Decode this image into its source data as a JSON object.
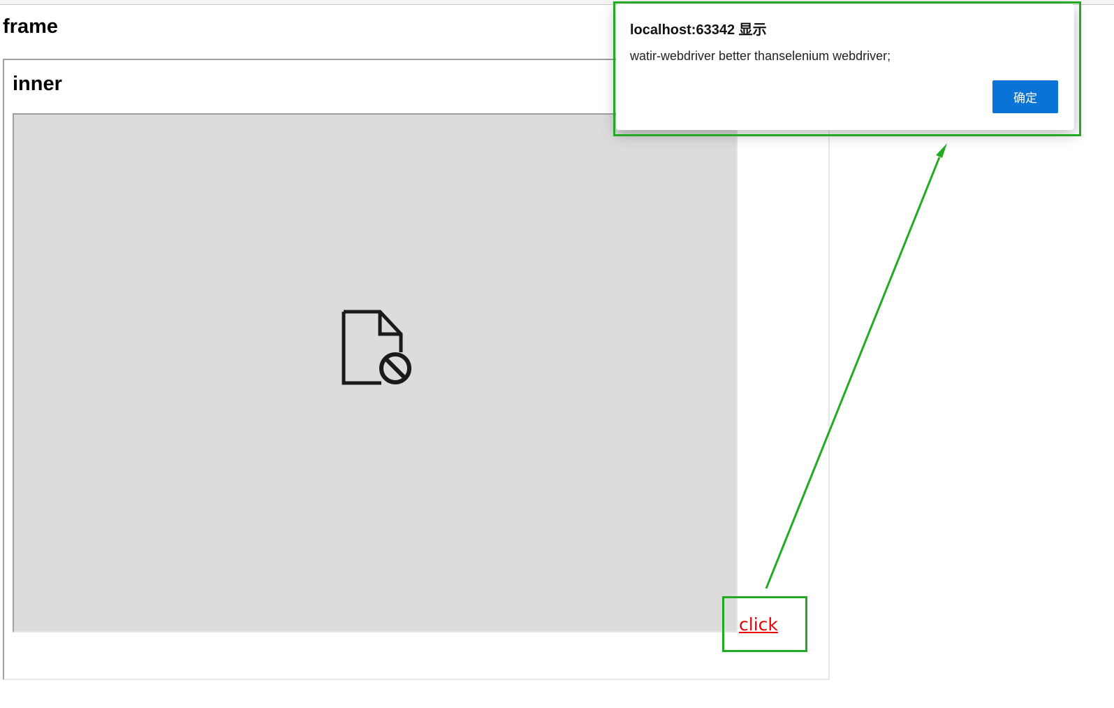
{
  "page": {
    "title": "frame"
  },
  "inner": {
    "title": "inner",
    "content_icon": "blocked-file-icon"
  },
  "link": {
    "label": "click"
  },
  "dialog": {
    "title": "localhost:63342 显示",
    "message": "watir-webdriver better thanselenium webdriver;",
    "ok_label": "确定"
  },
  "annotation": {
    "color": "#22aa22",
    "arrow": "green arrow from link to dialog"
  },
  "colors": {
    "link": "#ee0000",
    "ok_button": "#0a74d6",
    "inner_frame_bg": "#dcdcdc"
  }
}
